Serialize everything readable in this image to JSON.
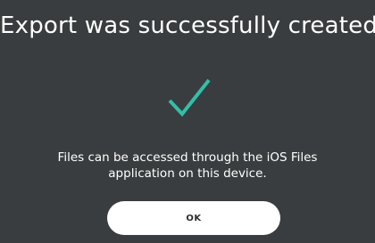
{
  "dialog": {
    "title": "Export was successfully created.",
    "icon": "checkmark-icon",
    "accent_color": "#33bfa6",
    "message_line1": "Files can be accessed through the iOS Files",
    "message_line2": "application on this device.",
    "ok_label": "OK"
  }
}
